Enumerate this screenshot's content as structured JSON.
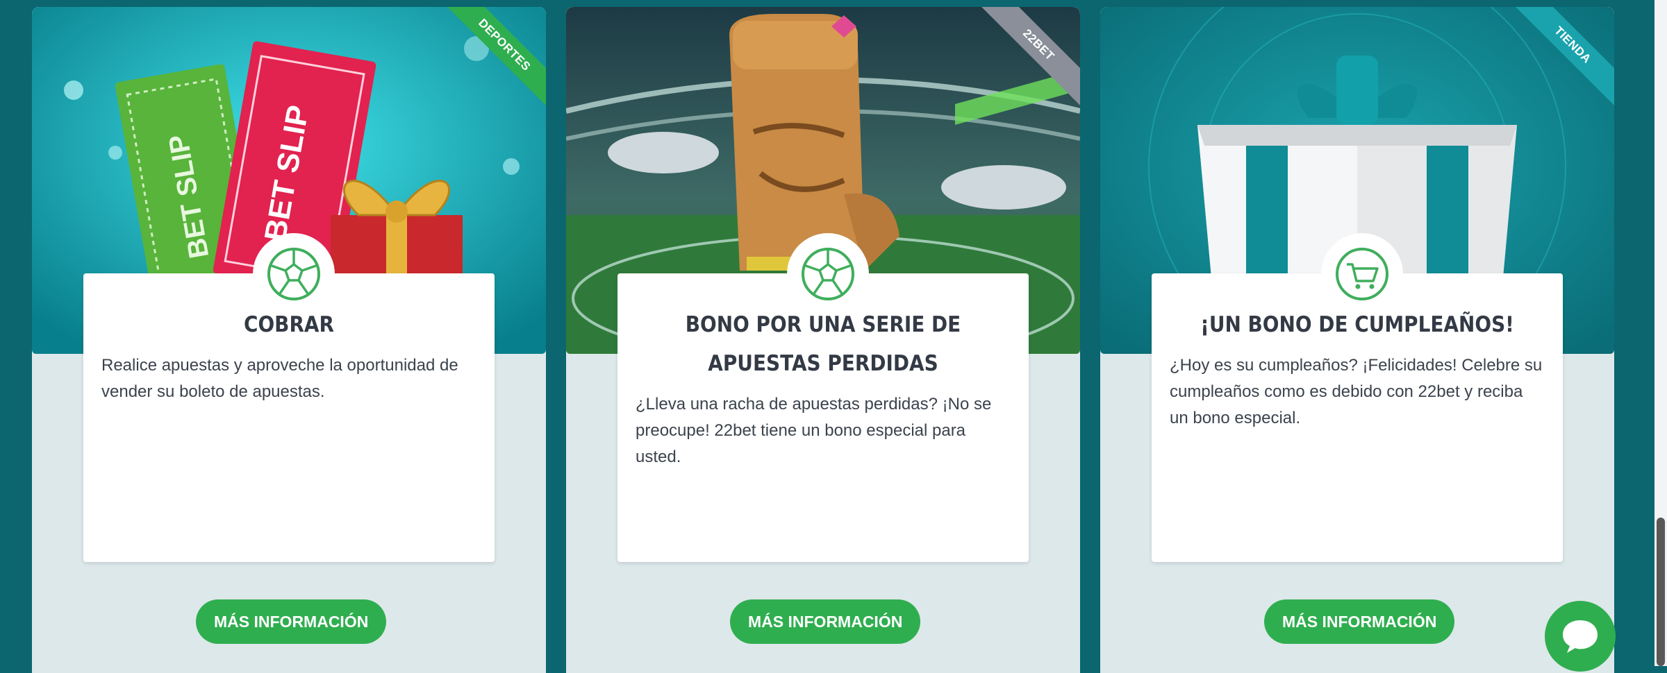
{
  "promos": [
    {
      "category": "DEPORTES",
      "category_color": "#2fae4f",
      "icon": "soccer-ball-icon",
      "title": "COBRAR",
      "description": "Realice apuestas y aproveche la oportunidad de vender su boleto de apuestas.",
      "button_label": "MÁS INFORMACIÓN"
    },
    {
      "category": "22BET",
      "category_color": "#8a8f99",
      "icon": "soccer-ball-icon",
      "title": "BONO POR UNA SERIE DE APUESTAS PERDIDAS",
      "description": "¿Lleva una racha de apuestas perdidas? ¡No se preocupe! 22bet tiene un bono especial para usted.",
      "button_label": "MÁS INFORMACIÓN"
    },
    {
      "category": "TIENDA",
      "category_color": "#1aa3ad",
      "icon": "shopping-cart-icon",
      "title": "¡UN BONO DE CUMPLEAÑOS!",
      "description": "¿Hoy es su cumpleaños? ¡Felicidades! Celebre su cumpleaños como es debido con 22bet y reciba un bono especial.",
      "button_label": "MÁS INFORMACIÓN"
    }
  ],
  "illustrations": {
    "bet_slip_text": "BET SLIP"
  },
  "chat": {
    "icon": "chat-bubble-icon"
  },
  "colors": {
    "accent": "#2fae4f",
    "page_bg": "#0b6670",
    "card_bg": "#dde8ea"
  }
}
